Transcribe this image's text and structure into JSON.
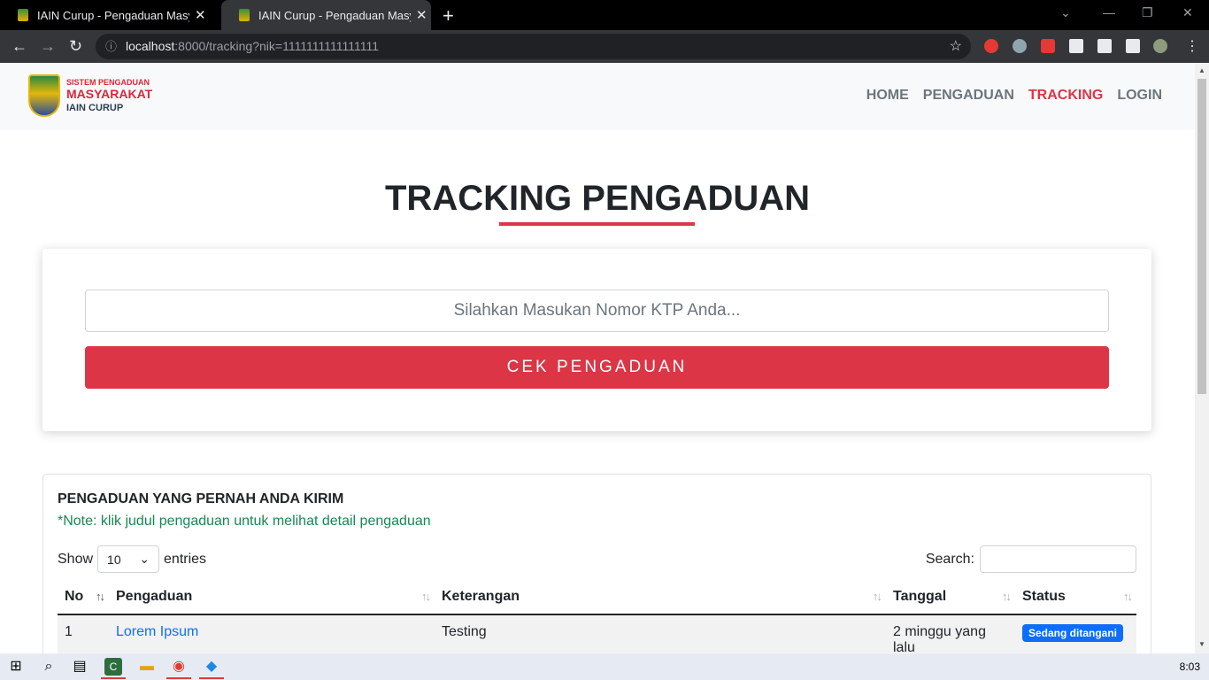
{
  "browser": {
    "tabs": [
      {
        "title": "IAIN Curup - Pengaduan Masyarakat"
      },
      {
        "title": "IAIN Curup - Pengaduan Masyarakat"
      }
    ],
    "url_host": "localhost",
    "url_rest": ":8000/tracking?nik=1111111111111111"
  },
  "header": {
    "logo_line1": "SISTEM PENGADUAN",
    "logo_line2": "MASYARAKAT",
    "logo_line3": "IAIN CURUP",
    "menu": [
      {
        "label": "HOME"
      },
      {
        "label": "PENGADUAN"
      },
      {
        "label": "TRACKING"
      },
      {
        "label": "LOGIN"
      }
    ]
  },
  "main": {
    "title": "TRACKING PENGADUAN",
    "ktp_placeholder": "Silahkan Masukan Nomor KTP Anda...",
    "cek_button": "CEK PENGADUAN"
  },
  "history": {
    "title": "PENGADUAN YANG PERNAH ANDA KIRIM",
    "note": "*Note: klik judul pengaduan untuk melihat detail pengaduan",
    "show_label": "Show",
    "entries_value": "10",
    "entries_label": "entries",
    "search_label": "Search:",
    "columns": [
      "No",
      "Pengaduan",
      "Keterangan",
      "Tanggal",
      "Status"
    ],
    "rows": [
      {
        "no": "1",
        "pengaduan": "Lorem Ipsum",
        "keterangan": "Testing",
        "tanggal": "2 minggu yang lalu",
        "status": "Sedang ditangani"
      }
    ]
  },
  "taskbar": {
    "time": "8:03"
  },
  "colors": {
    "accent": "#dc3545",
    "link": "#0d6efd",
    "note": "#198754"
  }
}
